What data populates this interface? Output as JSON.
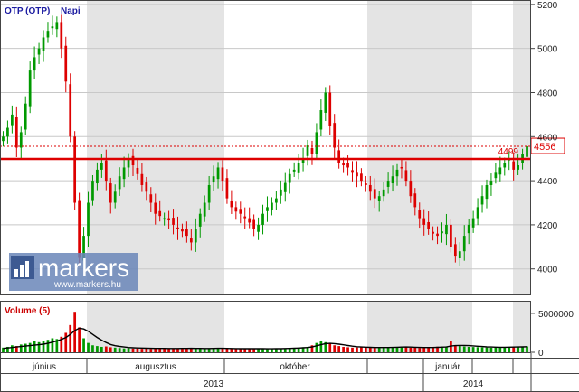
{
  "chart_data": [
    {
      "type": "candlestick",
      "title": "OTP (OTP)",
      "period": "Napi",
      "ylim": [
        3880,
        5220
      ],
      "y_ticks": [
        4000,
        4200,
        4400,
        4600,
        4800,
        5000,
        5200
      ],
      "month_labels": [
        "június",
        "augusztus",
        "október",
        "január"
      ],
      "year_labels": [
        "2013",
        "2014"
      ],
      "horizontal_lines": [
        {
          "value": 4499,
          "label": "4499",
          "style": "solid",
          "color": "#dd0000"
        },
        {
          "value": 4556,
          "label": "4556",
          "style": "dotted",
          "color": "#dd0000"
        }
      ],
      "close_series": [
        4600,
        4640,
        4700,
        4550,
        4620,
        4750,
        4900,
        4960,
        5000,
        5050,
        5080,
        5100,
        5120,
        5000,
        4850,
        4600,
        4300,
        4050,
        4150,
        4300,
        4400,
        4450,
        4480,
        4400,
        4300,
        4350,
        4420,
        4460,
        4500,
        4470,
        4430,
        4380,
        4350,
        4300,
        4250,
        4240,
        4230,
        4220,
        4200,
        4180,
        4170,
        4150,
        4120,
        4180,
        4250,
        4300,
        4380,
        4420,
        4460,
        4400,
        4320,
        4280,
        4260,
        4250,
        4230,
        4210,
        4180,
        4200,
        4250,
        4280,
        4300,
        4320,
        4360,
        4390,
        4430,
        4450,
        4480,
        4500,
        4560,
        4520,
        4620,
        4720,
        4800,
        4650,
        4550,
        4480,
        4470,
        4460,
        4440,
        4420,
        4400,
        4380,
        4350,
        4320,
        4330,
        4360,
        4400,
        4420,
        4450,
        4460,
        4400,
        4330,
        4280,
        4230,
        4200,
        4180,
        4160,
        4150,
        4170,
        4200,
        4100,
        4060,
        4080,
        4150,
        4200,
        4230,
        4280,
        4330,
        4380,
        4400,
        4440,
        4460,
        4480,
        4500,
        4450,
        4470,
        4520,
        4556
      ],
      "volume": {
        "label": "Volume (5)",
        "y_ticks": [
          0,
          5000000
        ],
        "ylim": [
          0,
          6500000
        ],
        "values": [
          600000,
          700000,
          900000,
          800000,
          1000000,
          1100000,
          1200000,
          1400000,
          1300000,
          1500000,
          1600000,
          1800000,
          1700000,
          2000000,
          2500000,
          3500000,
          5200000,
          3200000,
          1800000,
          1200000,
          900000,
          800000,
          700000,
          750000,
          650000,
          600000,
          550000,
          500000,
          520000,
          480000,
          500000,
          450000,
          460000,
          440000,
          480000,
          500000,
          470000,
          450000,
          430000,
          460000,
          480000,
          500000,
          520000,
          490000,
          470000,
          460000,
          450000,
          500000,
          520000,
          540000,
          480000,
          460000,
          450000,
          440000,
          430000,
          460000,
          480000,
          470000,
          450000,
          440000,
          460000,
          480000,
          500000,
          520000,
          540000,
          560000,
          600000,
          650000,
          700000,
          900000,
          1200000,
          1500000,
          1300000,
          1100000,
          900000,
          800000,
          700000,
          650000,
          600000,
          620000,
          640000,
          600000,
          580000,
          560000,
          600000,
          620000,
          640000,
          660000,
          700000,
          720000,
          650000,
          600000,
          580000,
          560000,
          600000,
          650000,
          700000,
          720000,
          740000,
          760000,
          1500000,
          900000,
          800000,
          750000,
          700000,
          680000,
          660000,
          640000,
          620000,
          600000,
          620000,
          640000,
          660000,
          680000,
          700000,
          720000,
          740000,
          760000
        ],
        "ma": [
          500000,
          560000,
          620000,
          680000,
          740000,
          800000,
          860000,
          920000,
          980000,
          1050000,
          1150000,
          1300000,
          1450000,
          1650000,
          1900000,
          2300000,
          2800000,
          3100000,
          3000000,
          2700000,
          2300000,
          1900000,
          1550000,
          1250000,
          1000000,
          850000,
          750000,
          680000,
          620000,
          580000,
          560000,
          540000,
          520000,
          510000,
          500000,
          500000,
          495000,
          490000,
          485000,
          490000,
          495000,
          500000,
          505000,
          500000,
          495000,
          490000,
          485000,
          495000,
          505000,
          515000,
          500000,
          490000,
          480000,
          470000,
          460000,
          460000,
          465000,
          465000,
          460000,
          455000,
          455000,
          460000,
          470000,
          485000,
          500000,
          520000,
          545000,
          575000,
          615000,
          700000,
          830000,
          980000,
          1100000,
          1150000,
          1120000,
          1050000,
          960000,
          870000,
          790000,
          720000,
          680000,
          660000,
          640000,
          620000,
          610000,
          610000,
          620000,
          630000,
          650000,
          670000,
          680000,
          670000,
          650000,
          630000,
          610000,
          610000,
          620000,
          640000,
          660000,
          680000,
          800000,
          860000,
          880000,
          880000,
          860000,
          820000,
          780000,
          740000,
          700000,
          680000,
          660000,
          650000,
          650000,
          660000,
          670000,
          680000,
          700000,
          720000
        ]
      }
    }
  ],
  "watermark": {
    "brand": "markers",
    "url": "www.markers.hu"
  },
  "colors": {
    "up": "#009900",
    "down": "#dd0000",
    "ma_line": "#000000",
    "shade": "#e4e4e4",
    "title": "#1a1aa0"
  }
}
